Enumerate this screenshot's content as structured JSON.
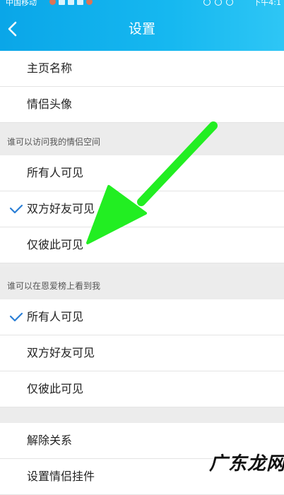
{
  "status_bar": {
    "carrier": "中国移动",
    "clock": "下午4:1"
  },
  "header": {
    "title": "设置"
  },
  "profile": {
    "items": [
      {
        "label": "主页名称"
      },
      {
        "label": "情侣头像"
      }
    ]
  },
  "visibility_space": {
    "title": "谁可以访问我的情侣空间",
    "options": [
      {
        "label": "所有人可见",
        "checked": false
      },
      {
        "label": "双方好友可见",
        "checked": true
      },
      {
        "label": "仅彼此可见",
        "checked": false
      }
    ]
  },
  "visibility_ranking": {
    "title": "谁可以在恩爱榜上看到我",
    "options": [
      {
        "label": "所有人可见",
        "checked": true
      },
      {
        "label": "双方好友可见",
        "checked": false
      },
      {
        "label": "仅彼此可见",
        "checked": false
      }
    ]
  },
  "actions": {
    "items": [
      {
        "label": "解除关系"
      },
      {
        "label": "设置情侣挂件"
      }
    ]
  },
  "watermark": {
    "text": "广东龙网"
  },
  "colors": {
    "header": "#16b8f0",
    "check": "#2b7fd6",
    "arrow": "#22ee22"
  }
}
